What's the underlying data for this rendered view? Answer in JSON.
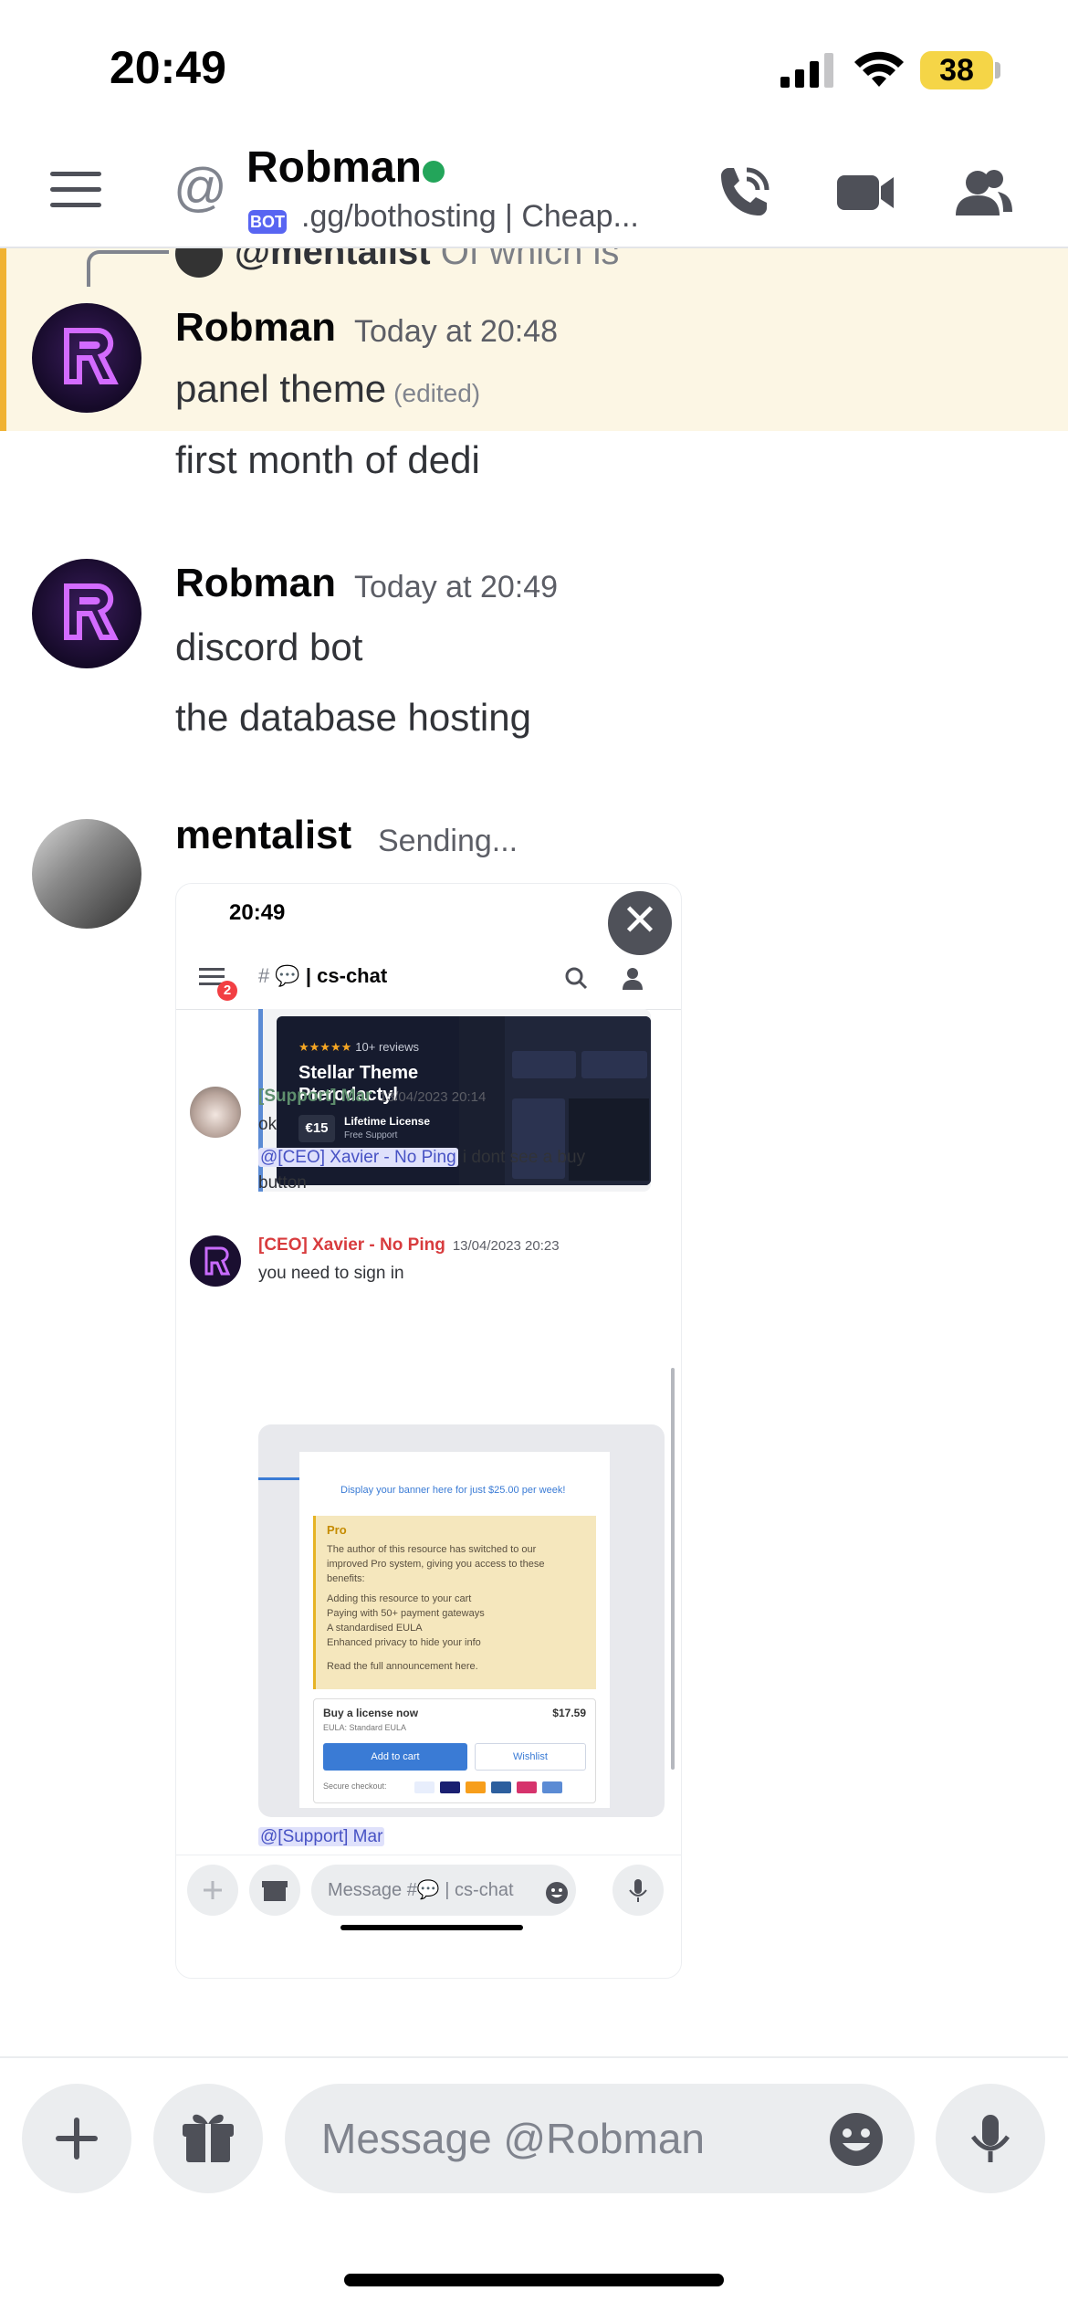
{
  "status_bar": {
    "time": "20:49",
    "battery": "38"
  },
  "header": {
    "at": "@",
    "name": "Robman",
    "bot_tag": "BOT",
    "subtitle": ".gg/bothosting | Cheap...",
    "icons": [
      "menu-icon",
      "call-icon",
      "video-icon",
      "members-icon"
    ]
  },
  "reply": {
    "username": "@mentalist",
    "text": "Of which is"
  },
  "messages": [
    {
      "author": "Robman",
      "time": "Today at 20:48",
      "lines": [
        "panel theme",
        "first month of dedi"
      ],
      "edited": "(edited)"
    },
    {
      "author": "Robman",
      "time": "Today at 20:49",
      "lines": [
        "discord bot",
        "the database hosting"
      ]
    },
    {
      "author": "mentalist",
      "time": "Sending..."
    }
  ],
  "attachment": {
    "time": "20:49",
    "channel_hash": "#",
    "channel": "💬 | cs-chat",
    "badge": "2",
    "promo": {
      "stars": "★★★★★",
      "reviews": "10+ reviews",
      "title_1": "Stellar Theme",
      "title_2": "Pterodactyl",
      "price": "€15",
      "license": "Lifetime License",
      "support": "Free Support"
    },
    "msg1": {
      "author": "[Support] Mar",
      "time": "13/04/2023 20:14",
      "line1": "ok",
      "mention": "@[CEO] Xavier - No Ping",
      "line2_rest": " i dont see a buy",
      "line3": "button"
    },
    "msg2": {
      "author": "[CEO] Xavier - No Ping",
      "time": "13/04/2023 20:23",
      "line1": "you need to sign in"
    },
    "inner_image": {
      "banner": "Display your banner here for just $25.00 per week!",
      "pro_title": "Pro",
      "pro_lines": [
        "The author of this resource has switched to our",
        "improved Pro system, giving you access to these",
        "benefits:",
        "Adding this resource to your cart",
        "Paying with 50+ payment gateways",
        "A standardised EULA",
        "Enhanced privacy to hide your info",
        "Read the full announcement here."
      ],
      "buy_title": "Buy a license now",
      "buy_price": "$17.59",
      "eula": "EULA: Standard EULA",
      "add_to_cart": "Add to cart",
      "wishlist": "Wishlist",
      "secure": "Secure checkout:"
    },
    "mention_bottom": "@[Support] Mar",
    "input_placeholder": "Message #💬 | cs-chat"
  },
  "composer": {
    "placeholder": "Message @Robman"
  },
  "colors": {
    "accent": "#5865f2",
    "online": "#23a55a",
    "highlight": "#fcf6e4",
    "highlight_bar": "#f0b232",
    "mention_bg": "#dfe1fb"
  }
}
